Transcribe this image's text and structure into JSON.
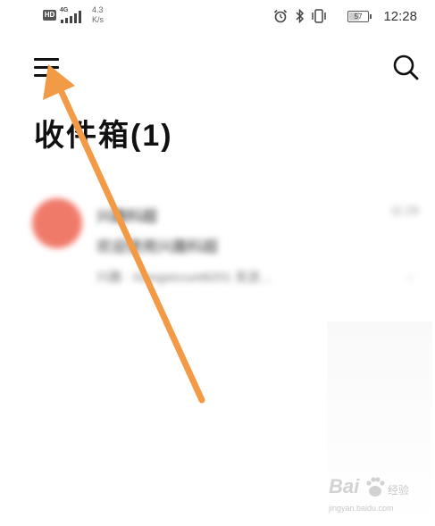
{
  "status_bar": {
    "hd_badge": "HD",
    "network": "4G",
    "speed_value": "4.3",
    "speed_unit": "K/s",
    "battery_level": "57",
    "time": "12:28",
    "icons": [
      "alarm-icon",
      "bluetooth-icon",
      "vibrate-icon",
      "battery-icon"
    ]
  },
  "toolbar": {
    "menu_icon": "hamburger-menu-icon",
    "search_icon": "search-icon"
  },
  "page_title": "收件箱(1)",
  "message_list": {
    "items": [
      {
        "sender": "兴趣科超",
        "subject": "欢迎使用兴趣科超",
        "preview": "兴趣 · Xiangsiccunt8201 发送…",
        "time": "11:29"
      }
    ]
  },
  "annotation": {
    "type": "arrow",
    "color": "#f29a45"
  },
  "watermark": {
    "brand": "Bai",
    "suffix": "经验",
    "url": "jingyan.baidu.com"
  }
}
